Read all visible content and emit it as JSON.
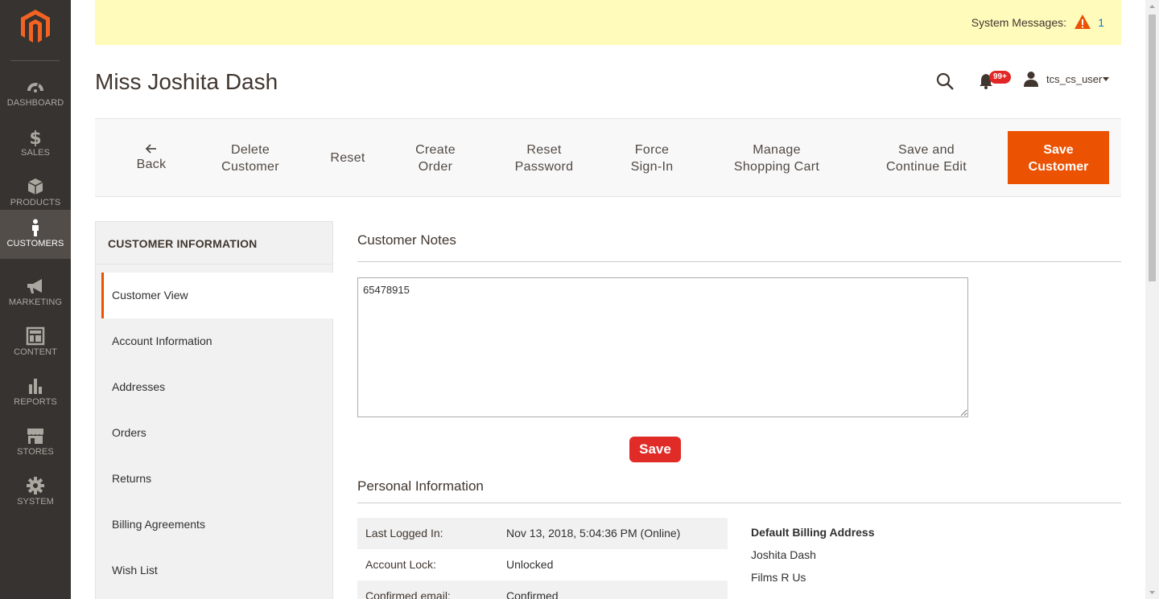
{
  "nav": {
    "items": [
      {
        "label": "DASHBOARD",
        "icon": "dashboard-icon"
      },
      {
        "label": "SALES",
        "icon": "dollar-icon"
      },
      {
        "label": "PRODUCTS",
        "icon": "box-icon"
      },
      {
        "label": "CUSTOMERS",
        "icon": "person-icon",
        "active": true
      },
      {
        "label": "MARKETING",
        "icon": "megaphone-icon"
      },
      {
        "label": "CONTENT",
        "icon": "layout-icon"
      },
      {
        "label": "REPORTS",
        "icon": "bar-chart-icon"
      },
      {
        "label": "STORES",
        "icon": "store-icon"
      },
      {
        "label": "SYSTEM",
        "icon": "gear-icon"
      }
    ]
  },
  "system_messages": {
    "label": "System Messages:",
    "count": "1"
  },
  "header": {
    "title": "Miss Joshita Dash",
    "notification_count": "99+",
    "username": "tcs_cs_user"
  },
  "actions": {
    "back": "Back",
    "delete_l1": "Delete",
    "delete_l2": "Customer",
    "reset": "Reset",
    "create_l1": "Create",
    "create_l2": "Order",
    "resetpw_l1": "Reset",
    "resetpw_l2": "Password",
    "force_l1": "Force",
    "force_l2": "Sign-In",
    "manage_l1": "Manage",
    "manage_l2": "Shopping Cart",
    "savecont_l1": "Save and",
    "savecont_l2": "Continue Edit",
    "save_l1": "Save",
    "save_l2": "Customer"
  },
  "tabs": {
    "title": "CUSTOMER INFORMATION",
    "items": [
      "Customer View",
      "Account Information",
      "Addresses",
      "Orders",
      "Returns",
      "Billing Agreements",
      "Wish List"
    ]
  },
  "notes": {
    "title": "Customer Notes",
    "value": "65478915",
    "save_label": "Save"
  },
  "personal": {
    "title": "Personal Information",
    "rows": [
      {
        "key": "Last Logged In:",
        "value": "Nov 13, 2018, 5:04:36 PM (Online)"
      },
      {
        "key": "Account Lock:",
        "value": "Unlocked"
      },
      {
        "key": "Confirmed email:",
        "value": "Confirmed"
      }
    ],
    "billing_heading": "Default Billing Address",
    "billing_lines": [
      "Joshita Dash",
      "Films R Us"
    ]
  },
  "colors": {
    "accent": "#eb5202",
    "nav_bg": "#373330",
    "sysbar_bg": "#fffbbb"
  }
}
